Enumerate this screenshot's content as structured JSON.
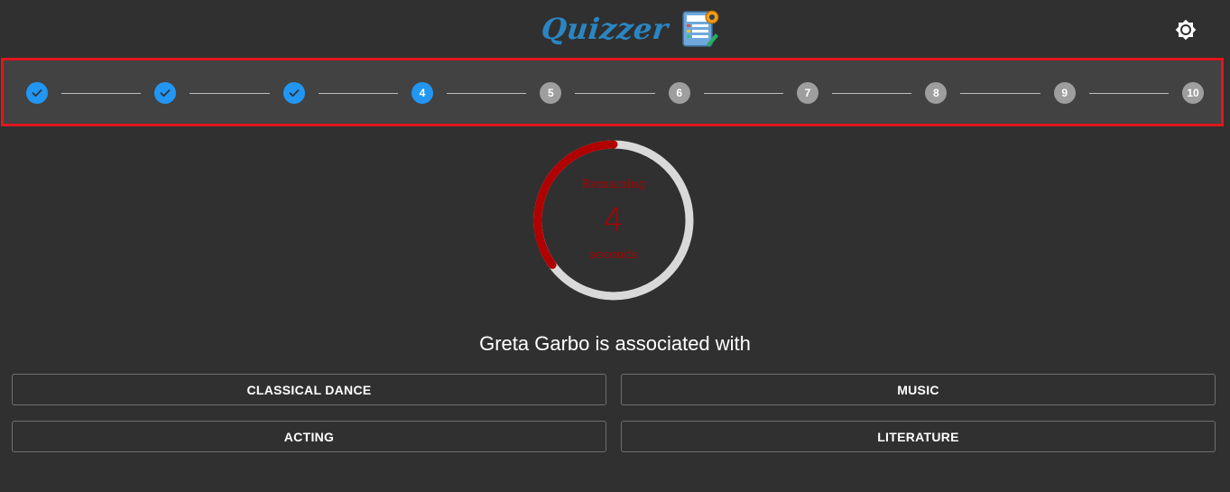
{
  "header": {
    "brand": "Quizzer",
    "logo_icon": "quiz-sheet-icon",
    "theme_toggle_icon": "brightness-icon"
  },
  "stepper": {
    "current": 4,
    "total": 10,
    "steps": [
      {
        "label": "1",
        "state": "done"
      },
      {
        "label": "2",
        "state": "done"
      },
      {
        "label": "3",
        "state": "done"
      },
      {
        "label": "4",
        "state": "active"
      },
      {
        "label": "5",
        "state": "pending"
      },
      {
        "label": "6",
        "state": "pending"
      },
      {
        "label": "7",
        "state": "pending"
      },
      {
        "label": "8",
        "state": "pending"
      },
      {
        "label": "9",
        "state": "pending"
      },
      {
        "label": "10",
        "state": "pending"
      }
    ],
    "highlight_color": "#e0161d",
    "done_color": "#2196f3",
    "pending_color": "#9e9e9e"
  },
  "timer": {
    "top_label": "Remaining",
    "value": "4",
    "bottom_label": "seconds",
    "progress_fraction": 0.35,
    "color": "#b00000",
    "track_color": "#d9d9d9"
  },
  "question": {
    "text": "Greta Garbo is associated with"
  },
  "answers": [
    {
      "label": "CLASSICAL DANCE"
    },
    {
      "label": "MUSIC"
    },
    {
      "label": "ACTING"
    },
    {
      "label": "LITERATURE"
    }
  ]
}
